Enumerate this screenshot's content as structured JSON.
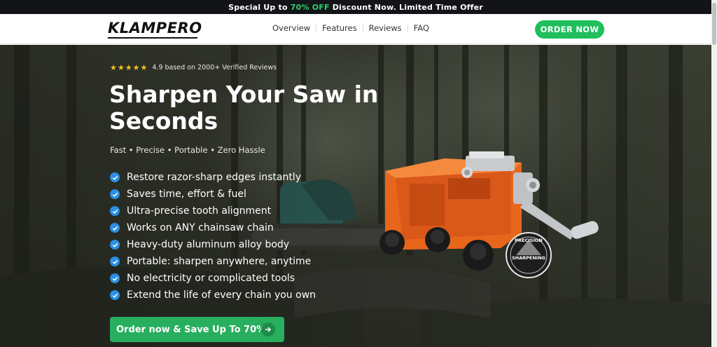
{
  "promo": {
    "prefix": "Special Up to ",
    "highlight": "70% OFF",
    "suffix": " Discount Now. Limited Time Offer"
  },
  "nav": {
    "logo": "KLAMPERO",
    "items": [
      "Overview",
      "Features",
      "Reviews",
      "FAQ"
    ],
    "order_button": "ORDER NOW"
  },
  "hero": {
    "rating_value": 5,
    "rating_text": "4.9 based on 2000+ Verified Reviews",
    "headline": "Sharpen Your Saw in Seconds",
    "subhead": "Fast • Precise • Portable • Zero Hassle",
    "features": [
      "Restore razor-sharp edges instantly",
      "Saves time, effort & fuel",
      "Ultra-precise tooth alignment",
      "Works on ANY chainsaw chain",
      "Heavy-duty aluminum alloy body",
      "Portable: sharpen anywhere, anytime",
      "No electricity or complicated tools",
      "Extend the life of every chain you own"
    ],
    "cta": "Order now & Save Up To 70%!",
    "badge_line1": "PRECISION",
    "badge_line2": "SHARPENING"
  },
  "colors": {
    "accent_green": "#1fbf5c",
    "highlight_green": "#2fd06a",
    "check_blue": "#2b8fe3",
    "star_yellow": "#f6c026",
    "product_orange": "#e8661c"
  }
}
